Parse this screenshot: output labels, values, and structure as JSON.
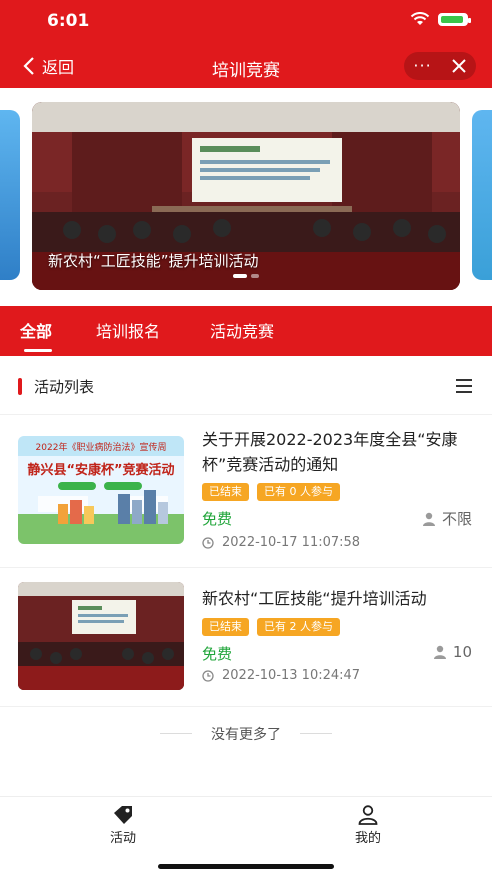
{
  "status_bar": {
    "time": "6:01"
  },
  "navbar": {
    "back_label": "返回",
    "title": "培训竞赛",
    "more_label": "···"
  },
  "banner": {
    "caption": "新农村“工匠技能”提升培训活动",
    "slide_count": 4,
    "active_slide": 1
  },
  "tabs": [
    {
      "label": "全部",
      "active": true
    },
    {
      "label": "培训报名",
      "active": false
    },
    {
      "label": "活动竞赛",
      "active": false
    }
  ],
  "list": {
    "title": "活动列表",
    "items": [
      {
        "title": "关于开展2022-2023年度全县“安康杯”竞赛活动的通知",
        "status": "已结束",
        "participants": "已有 0 人参与",
        "price": "免费",
        "quota": "不限",
        "time": "2022-10-17 11:07:58",
        "thumb_text_1": "2022年《职业病防治法》宣传周",
        "thumb_text_2": "静兴县“安康杯”竞赛活动"
      },
      {
        "title": "新农村“工匠技能“提升培训活动",
        "status": "已结束",
        "participants": "已有 2 人参与",
        "price": "免费",
        "quota": "10",
        "time": "2022-10-13 10:24:47"
      }
    ],
    "end_text": "没有更多了"
  },
  "bottom_nav": [
    {
      "label": "活动",
      "icon": "tag-icon",
      "active": true
    },
    {
      "label": "我的",
      "icon": "user-icon",
      "active": false
    }
  ],
  "colors": {
    "brand_red": "#e0191c",
    "badge_orange": "#f6a623",
    "price_green": "#20a53a"
  }
}
